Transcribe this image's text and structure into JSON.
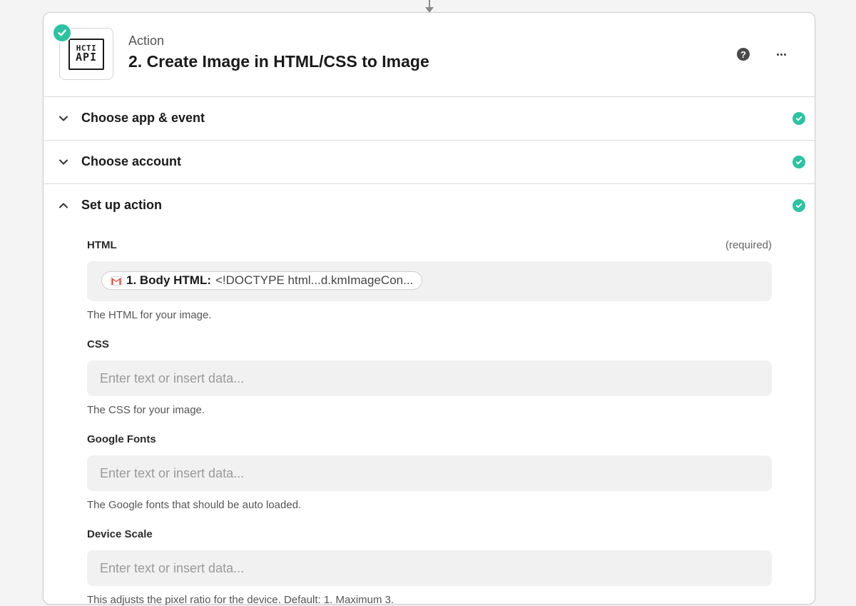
{
  "header": {
    "subtitle": "Action",
    "title": "2. Create Image in HTML/CSS to Image",
    "logo_line1": "HCTI",
    "logo_line2": "API",
    "help_glyph": "?"
  },
  "sections": [
    {
      "label": "Choose app & event",
      "state": "collapsed",
      "complete": true
    },
    {
      "label": "Choose account",
      "state": "collapsed",
      "complete": true
    },
    {
      "label": "Set up action",
      "state": "expanded",
      "complete": true
    }
  ],
  "fields": {
    "html": {
      "label": "HTML",
      "required": "(required)",
      "pill_step": "1. Body HTML:",
      "pill_value": "<!DOCTYPE html...d.kmImageCon...",
      "pill_icon": "gmail-icon",
      "help": "The HTML for your image."
    },
    "css": {
      "label": "CSS",
      "placeholder": "Enter text or insert data...",
      "help": "The CSS for your image."
    },
    "google_fonts": {
      "label": "Google Fonts",
      "placeholder": "Enter text or insert data...",
      "help": "The Google fonts that should be auto loaded."
    },
    "device_scale": {
      "label": "Device Scale",
      "placeholder": "Enter text or insert data...",
      "help": "This adjusts the pixel ratio for the device. Default: 1. Maximum 3."
    }
  },
  "colors": {
    "success": "#2fc2a2",
    "input_bg": "#f1f1f1",
    "gmail_red": "#d44638"
  }
}
